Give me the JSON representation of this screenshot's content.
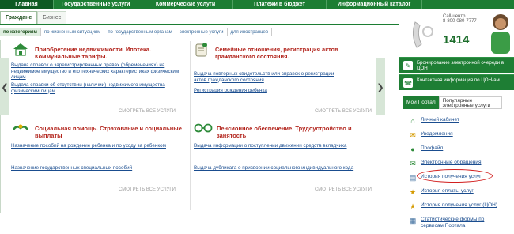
{
  "top_nav": {
    "tabs": [
      {
        "label": "Главная",
        "active": true
      },
      {
        "label": "Государственные услуги",
        "active": false
      },
      {
        "label": "Коммерческие услуги",
        "active": false
      },
      {
        "label": "Платежи в бюджет",
        "active": false
      },
      {
        "label": "Информационный каталог",
        "active": false
      }
    ]
  },
  "sub_tabs": [
    {
      "label": "Граждане",
      "active": true
    },
    {
      "label": "Бизнес",
      "active": false
    }
  ],
  "filters": [
    {
      "label": "по категориям",
      "active": true
    },
    {
      "label": "по жизненным ситуациям",
      "active": false
    },
    {
      "label": "по государственным органам",
      "active": false
    },
    {
      "label": "электронные услуги",
      "active": false
    },
    {
      "label": "для иностранцев",
      "active": false
    }
  ],
  "categories": [
    {
      "title": "Приобретение недвижимости. Ипотека. Коммунальные тарифы.",
      "icon": "house-icon",
      "links": [
        "Выдача справок о зарегистрированных правах (обременениях) на недвижимое имущество и его технических характеристиках физическим лицам",
        "Выдача справки об отсутствии (наличии) недвижимого имущества физическим лицам"
      ],
      "more": "СМОТРЕТЬ ВСЕ УСЛУГИ"
    },
    {
      "title": "Семейные отношения, регистрация актов гражданского состояния.",
      "icon": "scroll-icon",
      "links": [
        "Выдача повторных свидетельств или справок о регистрации актов гражданского состояния",
        "Регистрация рождения ребенка"
      ],
      "more": "СМОТРЕТЬ ВСЕ УСЛУГИ"
    },
    {
      "title": "Социальная помощь. Страхование и социальные выплаты",
      "icon": "hands-icon",
      "links": [
        "Назначение пособий на рождение ребенка и по уходу за ребенком",
        "Назначение государственных специальных пособий"
      ],
      "more": "СМОТРЕТЬ ВСЕ УСЛУГИ"
    },
    {
      "title": "Пенсионное обеспечение. Трудоустройство и занятость",
      "icon": "glasses-icon",
      "links": [
        "Выдача информации о поступлении движении средств вкладчика",
        "Выдача дубликата о присвоении социального индивидуального кода"
      ],
      "more": "СМОТРЕТЬ ВСЕ УСЛУГИ"
    }
  ],
  "right_panel": {
    "call_center_label": "Call-центр",
    "phone": "8-800-080-7777",
    "short_number": "1414",
    "green_items": [
      "Бронирование электронной очереди в ЦОН",
      "Контактная информация по ЦОН-ам"
    ],
    "tabs": [
      {
        "label": "Мой Портал",
        "active": true
      },
      {
        "label": "Популярные электронные услуги",
        "active": false
      }
    ],
    "menu": [
      {
        "label": "Личный кабинет",
        "icon": "home-icon"
      },
      {
        "label": "Уведомления",
        "icon": "bell-icon"
      },
      {
        "label": "Профайл",
        "icon": "profile-icon"
      },
      {
        "label": "Электронные обращения",
        "icon": "mail-icon"
      },
      {
        "label": "История получения услуг",
        "icon": "history-icon",
        "highlighted": true
      },
      {
        "label": "История оплаты услуг",
        "icon": "payment-icon"
      },
      {
        "label": "История получения услуг (ЦОН)",
        "icon": "history-con-icon"
      },
      {
        "label": "Статистические формы по сервисам Портала",
        "icon": "stats-icon"
      }
    ]
  }
}
